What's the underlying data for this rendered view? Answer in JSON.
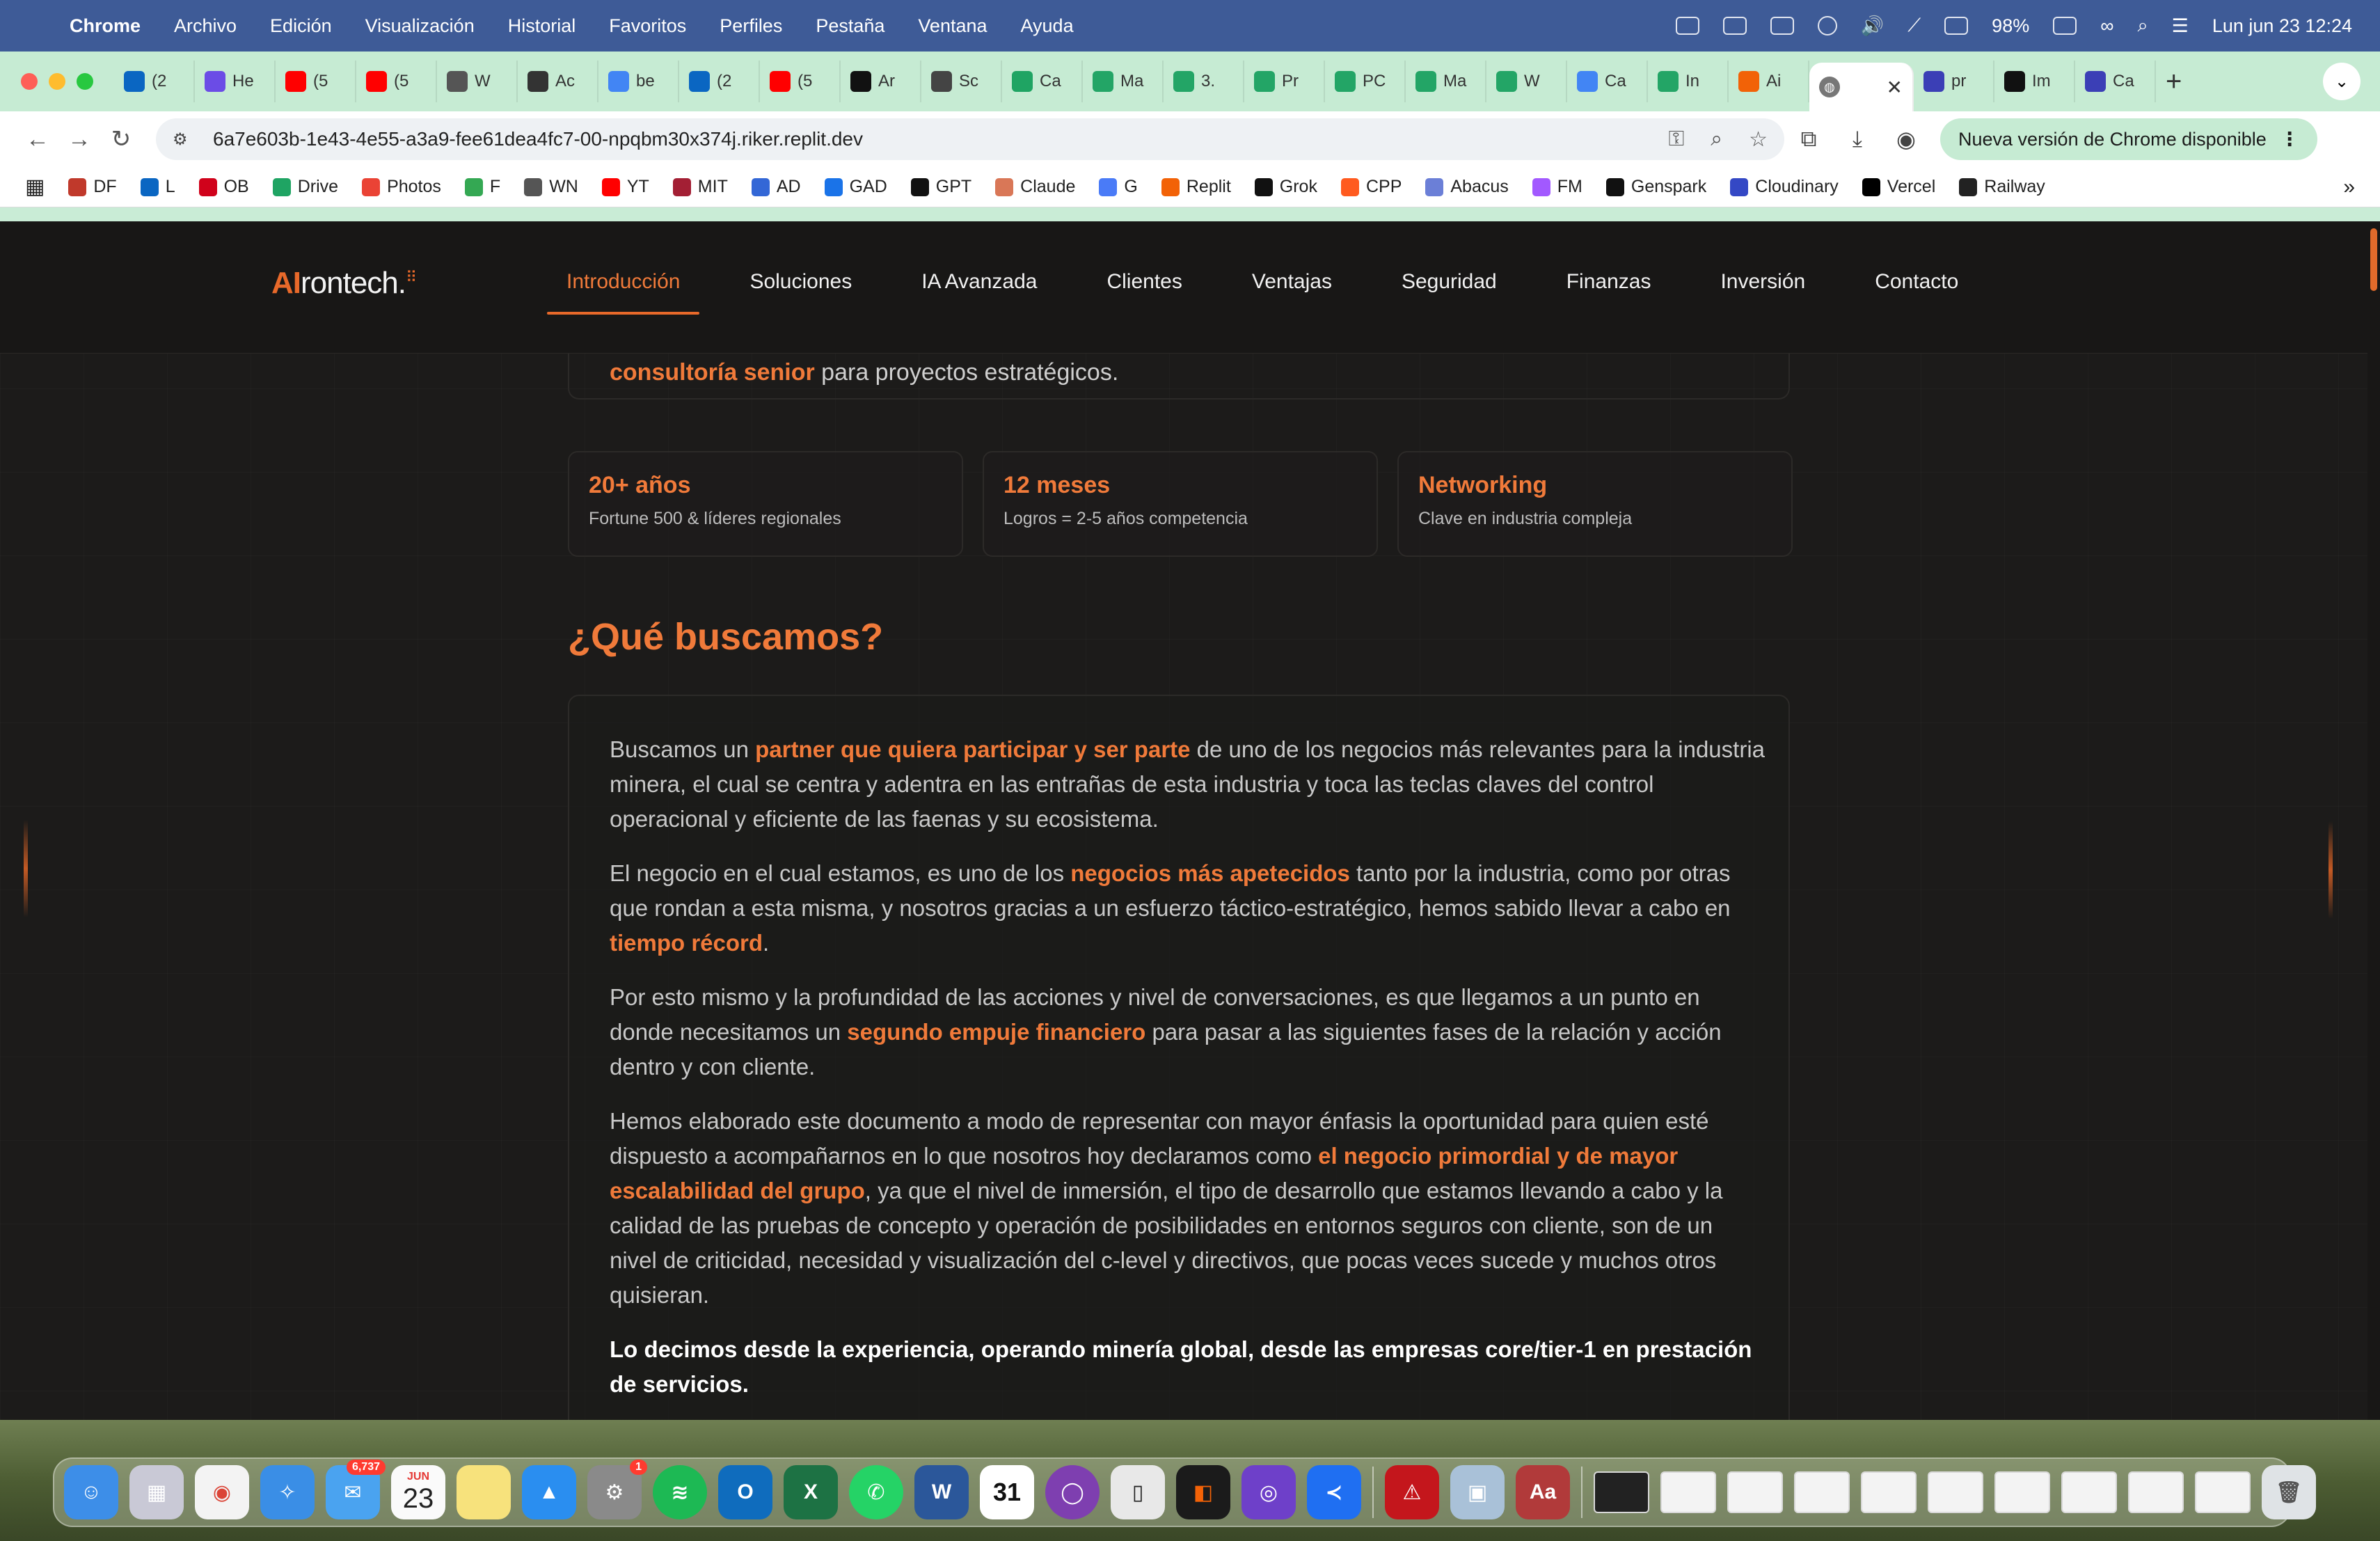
{
  "menubar": {
    "app_name": "Chrome",
    "items": [
      "Archivo",
      "Edición",
      "Visualización",
      "Historial",
      "Favoritos",
      "Perfiles",
      "Pestaña",
      "Ventana",
      "Ayuda"
    ],
    "battery": "98%",
    "datetime": "Lun jun 23  12:24"
  },
  "tabs": [
    {
      "label": "(2",
      "icon": "linkedin-icon",
      "color": "#0a66c2"
    },
    {
      "label": "He",
      "icon": "play-circle-icon",
      "color": "#6b4ce6"
    },
    {
      "label": "(5",
      "icon": "youtube-icon",
      "color": "#ff0000"
    },
    {
      "label": "(5",
      "icon": "youtube-icon",
      "color": "#ff0000"
    },
    {
      "label": "W",
      "icon": "page-icon",
      "color": "#555555"
    },
    {
      "label": "Ac",
      "icon": "openai-icon",
      "color": "#333333"
    },
    {
      "label": "be",
      "icon": "google-icon",
      "color": "#4285f4"
    },
    {
      "label": "(2",
      "icon": "linkedin-icon",
      "color": "#0a66c2"
    },
    {
      "label": "(5",
      "icon": "youtube-icon",
      "color": "#ff0000"
    },
    {
      "label": "Ar",
      "icon": "openai-icon",
      "color": "#111111"
    },
    {
      "label": "Sc",
      "icon": "openai-icon",
      "color": "#444444"
    },
    {
      "label": "Ca",
      "icon": "drive-icon",
      "color": "#1fa463"
    },
    {
      "label": "Ma",
      "icon": "sheets-icon",
      "color": "#23a566"
    },
    {
      "label": "3.",
      "icon": "sheets-icon",
      "color": "#23a566"
    },
    {
      "label": "Pr",
      "icon": "sheets-icon",
      "color": "#23a566"
    },
    {
      "label": "PC",
      "icon": "sheets-icon",
      "color": "#23a566"
    },
    {
      "label": "Ma",
      "icon": "sheets-icon",
      "color": "#23a566"
    },
    {
      "label": "W",
      "icon": "sheets-icon",
      "color": "#23a566"
    },
    {
      "label": "Ca",
      "icon": "docs-icon",
      "color": "#4285f4"
    },
    {
      "label": "In",
      "icon": "sheets-icon",
      "color": "#23a566"
    },
    {
      "label": "Ai",
      "icon": "replit-icon",
      "color": "#f26207"
    }
  ],
  "active_tab": {
    "icon": "globe-icon",
    "close": "✕"
  },
  "tabs_after": [
    {
      "label": "pr",
      "icon": "bank-icon",
      "color": "#3b3fb6"
    },
    {
      "label": "Im",
      "icon": "openai-icon",
      "color": "#111111"
    },
    {
      "label": "Ca",
      "icon": "bank-icon",
      "color": "#3b3fb6"
    }
  ],
  "new_tab": "+",
  "address": {
    "url": "6a7e603b-1e43-4e55-a3a9-fee61dea4fc7-00-npqbm30x374j.riker.replit.dev"
  },
  "update_pill": "Nueva versión de Chrome disponible",
  "bookmarks": [
    {
      "label": "DF",
      "color": "#c0392b"
    },
    {
      "label": "L",
      "color": "#0a66c2"
    },
    {
      "label": "OB",
      "color": "#d0021b"
    },
    {
      "label": "Drive",
      "color": "#1fa463"
    },
    {
      "label": "Photos",
      "color": "#ea4335"
    },
    {
      "label": "F",
      "color": "#34a853"
    },
    {
      "label": "WN",
      "color": "#555555"
    },
    {
      "label": "YT",
      "color": "#ff0000"
    },
    {
      "label": "MIT",
      "color": "#a31f34"
    },
    {
      "label": "AD",
      "color": "#3367d6"
    },
    {
      "label": "GAD",
      "color": "#1a73e8"
    },
    {
      "label": "GPT",
      "color": "#111111"
    },
    {
      "label": "Claude",
      "color": "#d97757"
    },
    {
      "label": "G",
      "color": "#4a7bf7"
    },
    {
      "label": "Replit",
      "color": "#f26207"
    },
    {
      "label": "Grok",
      "color": "#111111"
    },
    {
      "label": "CPP",
      "color": "#ff5a1f"
    },
    {
      "label": "Abacus",
      "color": "#6b7fd7"
    },
    {
      "label": "FM",
      "color": "#a259ff"
    },
    {
      "label": "Genspark",
      "color": "#111111"
    },
    {
      "label": "Cloudinary",
      "color": "#3448c5"
    },
    {
      "label": "Vercel",
      "color": "#000000"
    },
    {
      "label": "Railway",
      "color": "#222222"
    }
  ],
  "site": {
    "logo_ai": "AI",
    "logo_rest": "rontech.",
    "nav": [
      "Introducción",
      "Soluciones",
      "IA Avanzada",
      "Clientes",
      "Ventajas",
      "Seguridad",
      "Finanzas",
      "Inversión",
      "Contacto"
    ],
    "active_nav": "Introducción",
    "prev_card": {
      "highlight": "consultoría senior",
      "rest": " para proyectos estratégicos."
    },
    "stats": [
      {
        "value": "20+ años",
        "label": "Fortune 500 & líderes regionales"
      },
      {
        "value": "12 meses",
        "label": "Logros = 2-5 años competencia"
      },
      {
        "value": "Networking",
        "label": "Clave en industria compleja"
      }
    ],
    "section_title": "¿Qué buscamos?",
    "paragraphs": [
      {
        "p1_a": "Buscamos un ",
        "p1_hl": "partner que quiera participar y ser parte",
        "p1_b": " de uno de los negocios más relevantes para la industria minera, el cual se centra y adentra en las entrañas de esta industria y toca las teclas claves del control operacional y eficiente de las faenas y su ecosistema."
      }
    ],
    "p2_a": "El negocio en el cual estamos, es uno de los ",
    "p2_hl1": "negocios más apetecidos",
    "p2_b": " tanto por la industria, como por otras que rondan a esta misma, y nosotros gracias a un esfuerzo táctico-estratégico, hemos sabido llevar a cabo en ",
    "p2_hl2": "tiempo récord",
    "p2_c": ".",
    "p3_a": "Por esto mismo y la profundidad de las acciones y nivel de conversaciones, es que llegamos a un punto en donde necesitamos un ",
    "p3_hl": "segundo empuje financiero",
    "p3_b": " para pasar a las siguientes fases de la relación y acción dentro y con cliente.",
    "p4_a": "Hemos elaborado este documento a modo de representar con mayor énfasis la oportunidad para quien esté dispuesto a acompañarnos en lo que nosotros hoy declaramos como ",
    "p4_hl": "el negocio primordial y de mayor escalabilidad del grupo",
    "p4_b": ", ya que el nivel de inmersión, el tipo de desarrollo que estamos llevando a cabo y la calidad de las pruebas de concepto y operación de posibilidades en entornos seguros con cliente, son de un nivel de criticidad, necesidad y visualización del c-level y directivos, que pocas veces sucede y muchos otros quisieran.",
    "p5": "Lo decimos desde la experiencia, operando minería global, desde las empresas core/tier-1 en prestación de servicios."
  },
  "dock": {
    "mail_badge": "6,737",
    "settings_badge": "1",
    "calendar_month": "JUN",
    "calendar_day": "23",
    "calendar_app_day": "31",
    "dictionary_label": "Aa"
  },
  "colors": {
    "accent": "#f07a3a",
    "page_bg": "#1c1b1a",
    "menubar": "#3e5b97",
    "tabstrip": "#c6ebd3"
  }
}
